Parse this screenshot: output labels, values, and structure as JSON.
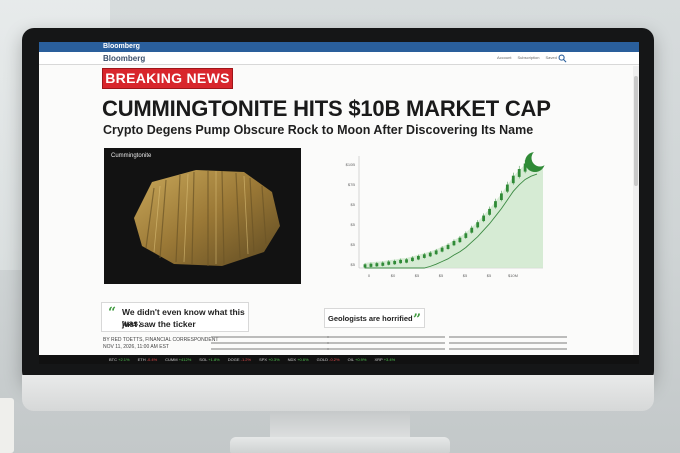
{
  "site": {
    "topbar_logo": "Bloomberg",
    "logo": "Bloomberg",
    "nav_links": [
      "Account",
      "Subscription",
      "Saved"
    ],
    "search_icon": "search-icon",
    "brand_color": "#2a5f9c"
  },
  "article": {
    "badge": "BREAKING NEWS",
    "headline": "CUMMINGTONITE HITS $10B MARKET CAP",
    "subheadline": "Crypto Degens Pump Obscure Rock to Moon After Discovering Its Name",
    "photo_caption": "Cummingtonite",
    "quote_left": [
      "We didn't even know what this was;",
      "just saw the ticker"
    ],
    "quote_right": "Geologists are horrified",
    "byline": [
      "BY RED TOETTS, FINANCIAL CORRESPONDENT",
      "NOV 11, 2026, 11:00 AM EST"
    ]
  },
  "ticker": [
    {
      "sym": "BTC",
      "chg": "+2.1%",
      "dir": "up"
    },
    {
      "sym": "ETH",
      "chg": "-0.4%",
      "dir": "dn"
    },
    {
      "sym": "CUMM",
      "chg": "+412%",
      "dir": "up"
    },
    {
      "sym": "SOL",
      "chg": "+1.8%",
      "dir": "up"
    },
    {
      "sym": "DOGE",
      "chg": "-1.2%",
      "dir": "dn"
    },
    {
      "sym": "SPX",
      "chg": "+0.3%",
      "dir": "up"
    },
    {
      "sym": "NDX",
      "chg": "+0.6%",
      "dir": "up"
    },
    {
      "sym": "GOLD",
      "chg": "-0.2%",
      "dir": "dn"
    },
    {
      "sym": "OIL",
      "chg": "+0.9%",
      "dir": "up"
    },
    {
      "sym": "XRP",
      "chg": "+3.4%",
      "dir": "up"
    }
  ],
  "chart_data": {
    "type": "line",
    "y_ticks": [
      "$10B",
      "$7B",
      "$5",
      "$5",
      "$5",
      "$5"
    ],
    "x_ticks": [
      "0",
      "$0",
      "$5",
      "$5",
      "$5",
      "$5",
      "$10M"
    ],
    "candles": [
      0.2,
      0.25,
      0.3,
      0.35,
      0.45,
      0.5,
      0.6,
      0.65,
      0.8,
      0.95,
      1.1,
      1.25,
      1.45,
      1.7,
      1.95,
      2.3,
      2.6,
      3.0,
      3.5,
      4.0,
      4.6,
      5.2,
      5.9,
      6.6,
      7.4,
      8.2,
      8.8,
      9.3,
      9.6,
      9.8
    ],
    "trend_line": true,
    "fill_color": "#cfe8cd",
    "candle_color": "#2f8a36",
    "moon_icon": "moon-icon"
  }
}
